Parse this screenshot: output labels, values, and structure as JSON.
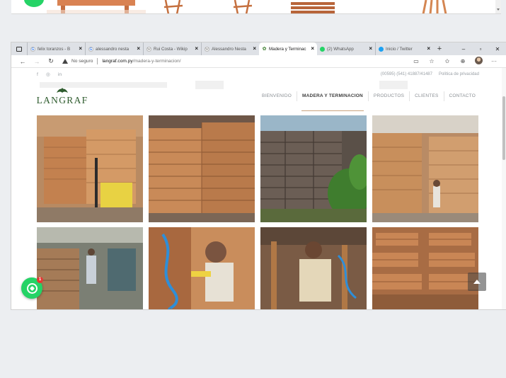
{
  "browser": {
    "tabs": [
      {
        "title": "felix toranzos - B",
        "favicon": "google-icon",
        "active": false
      },
      {
        "title": "alessandro nesta",
        "favicon": "google-icon",
        "active": false
      },
      {
        "title": "Rui Costa - Wikip",
        "favicon": "wikipedia-icon",
        "active": false
      },
      {
        "title": "Alessandro Nesta",
        "favicon": "wikipedia-icon",
        "active": false
      },
      {
        "title": "Madera y Terminac",
        "favicon": "langraf-icon",
        "active": true
      },
      {
        "title": "(2) WhatsApp",
        "favicon": "whatsapp-icon",
        "active": false
      },
      {
        "title": "Inicio / Twitter",
        "favicon": "twitter-icon",
        "active": false
      }
    ],
    "new_tab": "+",
    "window_controls": {
      "minimize": "–",
      "maximize": "▫",
      "close": "✕"
    },
    "address": {
      "security_label": "No seguro",
      "host": "langraf.com.py",
      "path": "/madera-y-terminacion/"
    },
    "toolbar_icons": [
      "reader-icon",
      "favorite-icon",
      "favorites-list-icon",
      "collections-icon",
      "profile-icon",
      "more-icon"
    ]
  },
  "site": {
    "topbar": {
      "social": [
        "f",
        "◎",
        "in"
      ],
      "phone": "(00595) (541) 41887/41487",
      "privacy": "Política de privacidad"
    },
    "logo_text": "LANGRAF",
    "menu": [
      {
        "label": "BIENVENIDO",
        "active": false
      },
      {
        "label": "MADERA Y TERMINACION",
        "active": true
      },
      {
        "label": "PRODUCTOS",
        "active": false
      },
      {
        "label": "CLIENTES",
        "active": false
      },
      {
        "label": "CONTACTO",
        "active": false
      }
    ],
    "gallery": [
      {
        "subject": "lumber-stacks-forklift"
      },
      {
        "subject": "lumber-stacks-warehouse"
      },
      {
        "subject": "wooden-pallets-outdoor"
      },
      {
        "subject": "lumber-stacks-worker"
      },
      {
        "subject": "workshop-shelves-workers"
      },
      {
        "subject": "worker-air-tool"
      },
      {
        "subject": "worker-chair-assembly"
      },
      {
        "subject": "finished-tables"
      }
    ],
    "whatsapp_badge": "1"
  },
  "colors": {
    "brand_green": "#2e5b2d",
    "whatsapp": "#25d366",
    "tab_strip": "#dee1e6",
    "active_menu_underline": "#c9a27d"
  }
}
